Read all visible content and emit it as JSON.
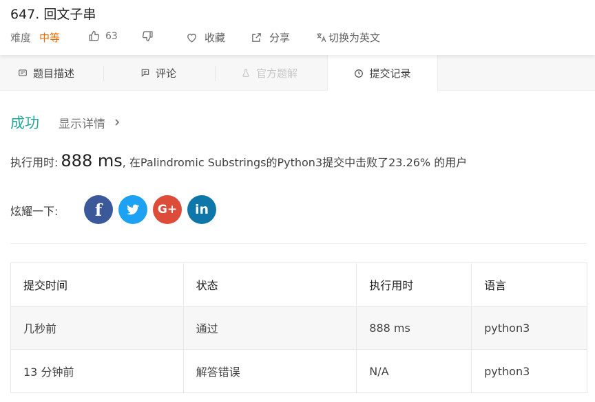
{
  "problem": {
    "title": "647. 回文子串",
    "difficulty_label": "难度",
    "difficulty_value": "中等",
    "likes": "63",
    "favorite_label": "收藏",
    "share_label": "分享",
    "lang_switch_label": "切换为英文"
  },
  "tabs": [
    {
      "label": "题目描述",
      "icon": "description-icon"
    },
    {
      "label": "评论",
      "icon": "comment-icon"
    },
    {
      "label": "官方题解",
      "icon": "flask-icon"
    },
    {
      "label": "提交记录",
      "icon": "clock-icon"
    }
  ],
  "result": {
    "status": "成功",
    "details_label": "显示详情",
    "runtime_prefix": "执行用时:",
    "runtime_value": "888 ms",
    "runtime_suffix": ", 在Palindromic Substrings的Python3提交中击败了23.26% 的用户",
    "flaunt_label": "炫耀一下:"
  },
  "social": [
    {
      "name": "facebook",
      "glyph": "f",
      "color": "#3b5998"
    },
    {
      "name": "twitter",
      "glyph": "t",
      "color": "#1da1f2"
    },
    {
      "name": "google-plus",
      "glyph": "G+",
      "color": "#dd4b39"
    },
    {
      "name": "linkedin",
      "glyph": "in",
      "color": "#0e76a8"
    }
  ],
  "table": {
    "headers": [
      "提交时间",
      "状态",
      "执行用时",
      "语言"
    ],
    "rows": [
      {
        "time": "几秒前",
        "status": "通过",
        "runtime": "888 ms",
        "lang": "python3"
      },
      {
        "time": "13 分钟前",
        "status": "解答错误",
        "runtime": "N/A",
        "lang": "python3"
      }
    ]
  },
  "colors": {
    "accent": "#26a69a",
    "difficulty": "#ef6c00",
    "error": "#e53935"
  }
}
